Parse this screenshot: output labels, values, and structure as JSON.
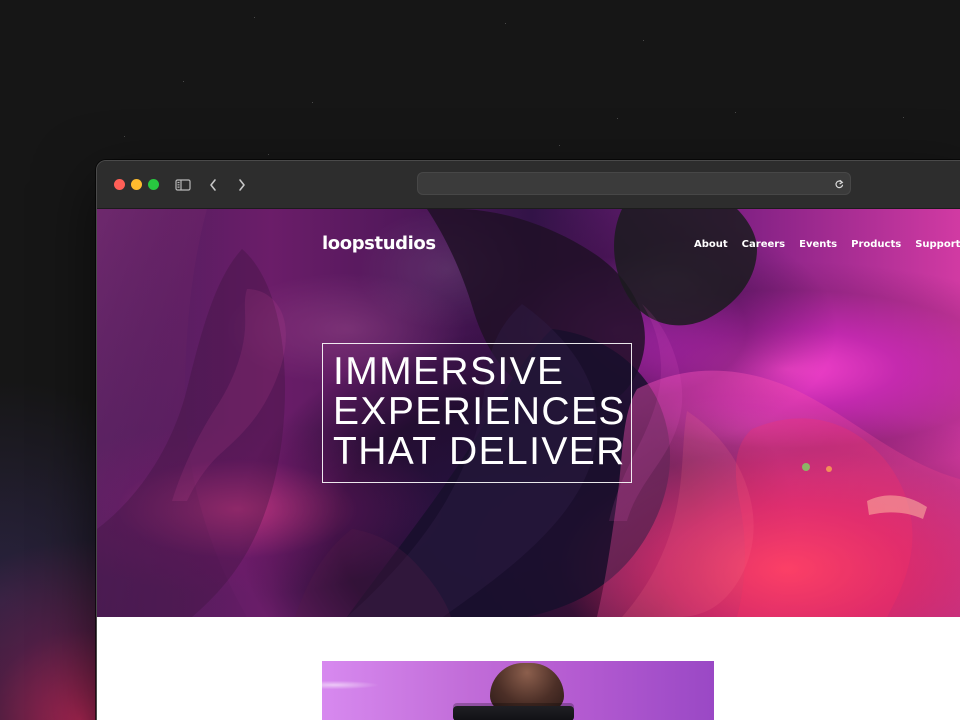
{
  "browser": {
    "address_value": "",
    "address_placeholder": "",
    "icons": {
      "sidebar": "sidebar-icon",
      "back": "chevron-left-icon",
      "forward": "chevron-right-icon",
      "reload": "reload-icon"
    },
    "colors": {
      "close": "#ff5f57",
      "minimize": "#febc2e",
      "zoom": "#28c840"
    }
  },
  "site": {
    "logo": "loopstudios",
    "nav": [
      "About",
      "Careers",
      "Events",
      "Products",
      "Support"
    ],
    "hero": {
      "headline_lines": [
        "IMMERSIVE",
        "EXPERIENCES",
        "THAT DELIVER"
      ]
    }
  }
}
